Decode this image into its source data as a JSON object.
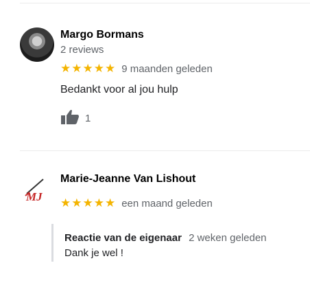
{
  "reviews": [
    {
      "author": "Margo Bormans",
      "author_meta": "2 reviews",
      "rating": 5,
      "stars": "★★★★★",
      "time": "9 maanden geleden",
      "text": "Bedankt voor al jou hulp",
      "likes": "1",
      "avatar_icon": "profile-photo"
    },
    {
      "author": "Marie-Jeanne Van Lishout",
      "rating": 5,
      "stars": "★★★★★",
      "time": "een maand geleden",
      "avatar_icon": "mj-logo",
      "avatar_logo_text": "MJ",
      "owner_reply": {
        "title": "Reactie van de eigenaar",
        "time": "2 weken geleden",
        "text": "Dank je wel !"
      }
    }
  ],
  "colors": {
    "star": "#f4b400",
    "meta_text": "#5f6368",
    "logo_red": "#c62828"
  }
}
